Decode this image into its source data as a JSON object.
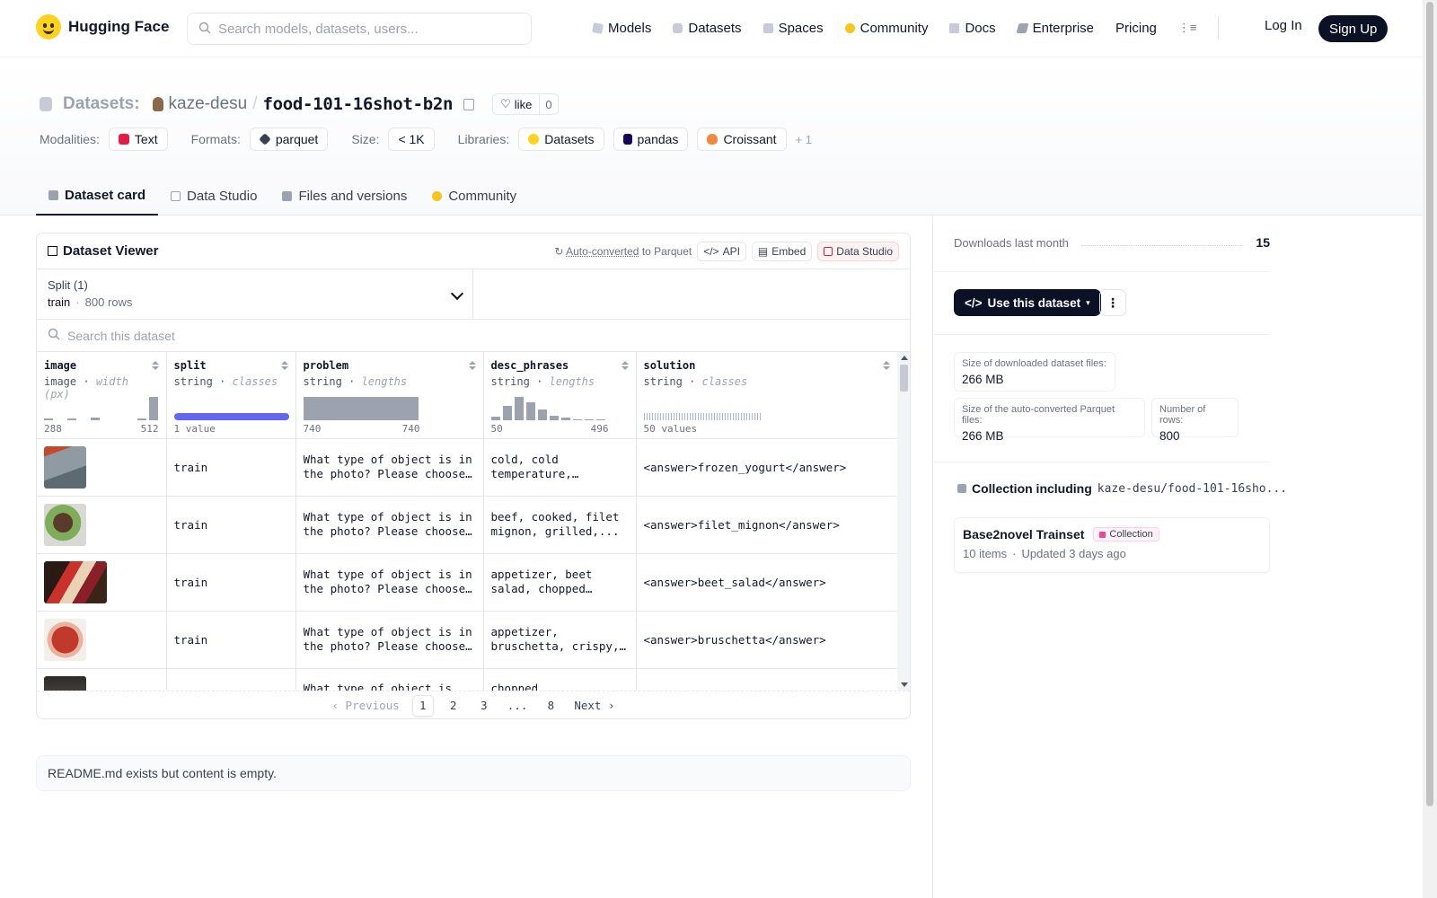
{
  "nav": {
    "brand": "Hugging Face",
    "search_placeholder": "Search models, datasets, users...",
    "links": [
      "Models",
      "Datasets",
      "Spaces",
      "Community",
      "Docs",
      "Enterprise",
      "Pricing"
    ],
    "login": "Log In",
    "signup": "Sign Up"
  },
  "repo": {
    "kind": "Datasets:",
    "owner": "kaze-desu",
    "slash": "/",
    "name": "food-101-16shot-b2n",
    "like_label": "like",
    "like_count": "0"
  },
  "meta": {
    "modalities_label": "Modalities:",
    "modality": "Text",
    "formats_label": "Formats:",
    "format": "parquet",
    "size_label": "Size:",
    "size": "< 1K",
    "libraries_label": "Libraries:",
    "libraries": [
      "Datasets",
      "pandas",
      "Croissant"
    ],
    "more": "+ 1"
  },
  "tabs": [
    "Dataset card",
    "Data Studio",
    "Files and versions",
    "Community"
  ],
  "viewer": {
    "title": "Dataset Viewer",
    "auto_converted": "Auto-converted",
    "to_parquet": "to Parquet",
    "api": "API",
    "embed": "Embed",
    "data_studio": "Data Studio",
    "split_label": "Split (1)",
    "split_name": "train",
    "split_dot": "·",
    "split_rows": "800 rows",
    "search_placeholder": "Search this dataset",
    "columns": [
      {
        "name": "image",
        "type": "image",
        "stat": "width (px)",
        "min": "288",
        "max": "512"
      },
      {
        "name": "split",
        "type": "string",
        "stat": "classes",
        "summary": "1 value"
      },
      {
        "name": "problem",
        "type": "string",
        "stat": "lengths",
        "min": "740",
        "max": "740"
      },
      {
        "name": "desc_phrases",
        "type": "string",
        "stat": "lengths",
        "min": "50",
        "max": "496"
      },
      {
        "name": "solution",
        "type": "string",
        "stat": "classes",
        "summary": "50 values"
      }
    ],
    "type_sep": " · ",
    "rows": [
      {
        "split": "train",
        "problem": "What type of object is in the photo? Please choose one...",
        "desc": "cold, cold temperature, colorful...",
        "solution": "<answer>frozen_yogurt</answer>"
      },
      {
        "split": "train",
        "problem": "What type of object is in the photo? Please choose one...",
        "desc": "beef, cooked, filet mignon, grilled,...",
        "solution": "<answer>filet_mignon</answer>"
      },
      {
        "split": "train",
        "problem": "What type of object is in the photo? Please choose one...",
        "desc": "appetizer, beet salad, chopped beets,...",
        "solution": "<answer>beet_salad</answer>"
      },
      {
        "split": "train",
        "problem": "What type of object is in the photo? Please choose one...",
        "desc": "appetizer, bruschetta, crispy, crispy...",
        "solution": "<answer>bruschetta</answer>"
      },
      {
        "split": "",
        "problem": "What type of object is in...",
        "desc": "chopped vegetables,...",
        "solution": ""
      }
    ],
    "pager": {
      "prev": "Previous",
      "pages": [
        "1",
        "2",
        "3",
        "...",
        "8"
      ],
      "next": "Next"
    }
  },
  "readme": "README.md exists but content is empty.",
  "sidebar": {
    "downloads_label": "Downloads last month",
    "downloads": "15",
    "use_button": "Use this dataset",
    "stats": [
      {
        "label": "Size of downloaded dataset files:",
        "value": "266 MB"
      },
      {
        "label": "Size of the auto-converted Parquet files:",
        "value": "266 MB"
      },
      {
        "label": "Number of rows:",
        "value": "800"
      }
    ],
    "collection_heading": "Collection including",
    "collection_path": "kaze-desu/food-101-16sho...",
    "collection": {
      "title": "Base2novel Trainset",
      "badge": "Collection",
      "items": "10 items",
      "updated": "Updated 3 days ago"
    }
  },
  "colors": {
    "accent_dark": "#0b1225",
    "split_bar": "#6366f1",
    "brand_yellow": "#ffd21e"
  }
}
